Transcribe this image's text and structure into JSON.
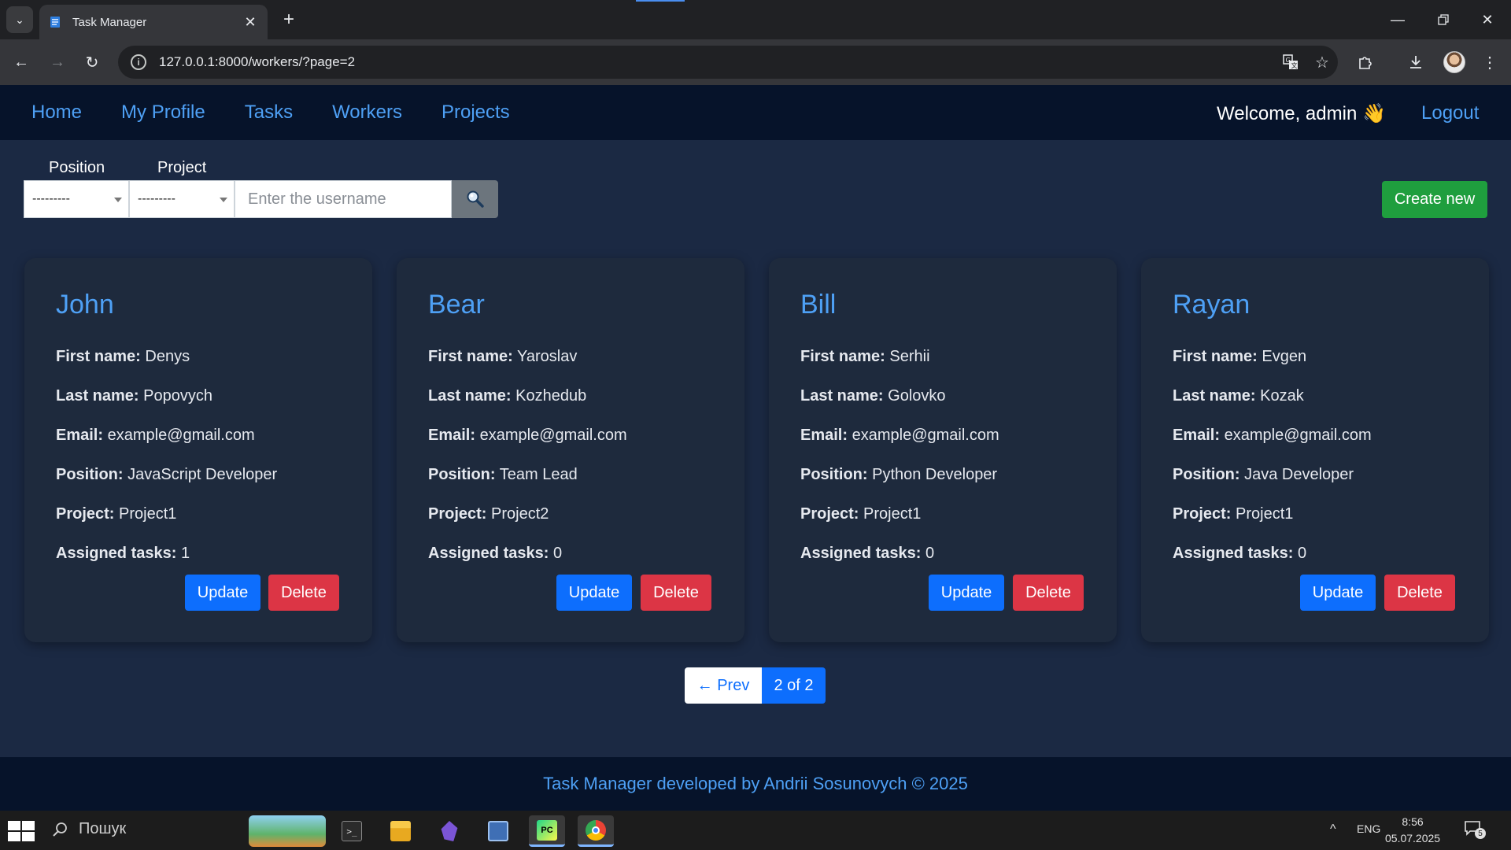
{
  "browser": {
    "tab_title": "Task Manager",
    "url": "127.0.0.1:8000/workers/?page=2"
  },
  "nav": {
    "links": [
      "Home",
      "My Profile",
      "Tasks",
      "Workers",
      "Projects"
    ],
    "welcome": "Welcome, admin 👋",
    "logout": "Logout"
  },
  "filters": {
    "position_label": "Position",
    "project_label": "Project",
    "position_value": "---------",
    "project_value": "---------",
    "search_placeholder": "Enter the username",
    "create_label": "Create new"
  },
  "workers": [
    {
      "username": "John",
      "first_name_label": "First name:",
      "first_name": "Denys",
      "last_name_label": "Last name:",
      "last_name": "Popovych",
      "email_label": "Email:",
      "email": "example@gmail.com",
      "position_label": "Position:",
      "position": "JavaScript Developer",
      "project_label": "Project:",
      "project": "Project1",
      "tasks_label": "Assigned tasks:",
      "tasks": "1",
      "update": "Update",
      "delete": "Delete"
    },
    {
      "username": "Bear",
      "first_name_label": "First name:",
      "first_name": "Yaroslav",
      "last_name_label": "Last name:",
      "last_name": "Kozhedub",
      "email_label": "Email:",
      "email": "example@gmail.com",
      "position_label": "Position:",
      "position": "Team Lead",
      "project_label": "Project:",
      "project": "Project2",
      "tasks_label": "Assigned tasks:",
      "tasks": "0",
      "update": "Update",
      "delete": "Delete"
    },
    {
      "username": "Bill",
      "first_name_label": "First name:",
      "first_name": "Serhii",
      "last_name_label": "Last name:",
      "last_name": "Golovko",
      "email_label": "Email:",
      "email": "example@gmail.com",
      "position_label": "Position:",
      "position": "Python Developer",
      "project_label": "Project:",
      "project": "Project1",
      "tasks_label": "Assigned tasks:",
      "tasks": "0",
      "update": "Update",
      "delete": "Delete"
    },
    {
      "username": "Rayan",
      "first_name_label": "First name:",
      "first_name": "Evgen",
      "last_name_label": "Last name:",
      "last_name": "Kozak",
      "email_label": "Email:",
      "email": "example@gmail.com",
      "position_label": "Position:",
      "position": "Java Developer",
      "project_label": "Project:",
      "project": "Project1",
      "tasks_label": "Assigned tasks:",
      "tasks": "0",
      "update": "Update",
      "delete": "Delete"
    }
  ],
  "pagination": {
    "prev": "← Prev",
    "current": "2 of 2"
  },
  "footer": {
    "text": "Task Manager developed by Andrii Sosunovych © 2025"
  },
  "taskbar": {
    "search": "Пошук",
    "language": "ENG",
    "time": "8:56",
    "date": "05.07.2025",
    "notifications": "5"
  },
  "colors": {
    "accent": "#4ea0f5",
    "primary": "#0d6efd",
    "danger": "#dc3545",
    "success": "#1f9e3e",
    "page_bg": "#1b2943",
    "card_bg": "#1e2a3d",
    "navbar_bg": "#06132a"
  },
  "icons": {
    "search_button": "magnifier-icon",
    "tab_favicon": "task-manager-favicon",
    "back": "back-arrow-icon",
    "forward": "forward-arrow-icon",
    "reload": "reload-icon",
    "info": "site-info-icon",
    "translate": "translate-icon",
    "bookmark": "star-icon",
    "extensions": "puzzle-icon",
    "download": "download-icon",
    "menu": "kebab-menu-icon"
  }
}
